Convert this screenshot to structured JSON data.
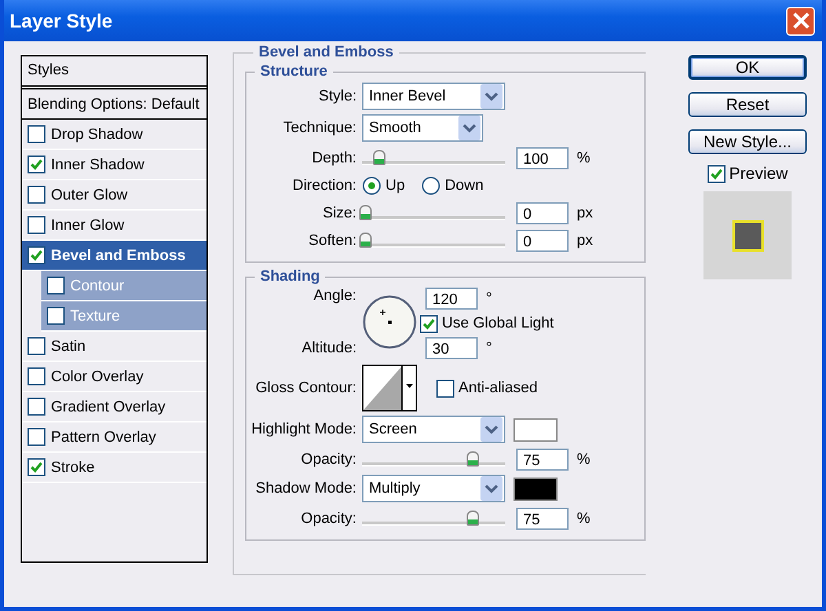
{
  "window": {
    "title": "Layer Style"
  },
  "styles_list": {
    "header": "Styles",
    "items": [
      {
        "label": "Blending Options: Default",
        "kind": "plain",
        "selected": false
      },
      {
        "label": "Drop Shadow",
        "kind": "check",
        "checked": false,
        "selected": false
      },
      {
        "label": "Inner Shadow",
        "kind": "check",
        "checked": true,
        "selected": false
      },
      {
        "label": "Outer Glow",
        "kind": "check",
        "checked": false,
        "selected": false
      },
      {
        "label": "Inner Glow",
        "kind": "check",
        "checked": false,
        "selected": false
      },
      {
        "label": "Bevel and Emboss",
        "kind": "check",
        "checked": true,
        "selected": true,
        "children": [
          {
            "label": "Contour",
            "kind": "check",
            "checked": false,
            "selected": false
          },
          {
            "label": "Texture",
            "kind": "check",
            "checked": false,
            "selected": false
          }
        ]
      },
      {
        "label": "Satin",
        "kind": "check",
        "checked": false,
        "selected": false
      },
      {
        "label": "Color Overlay",
        "kind": "check",
        "checked": false,
        "selected": false
      },
      {
        "label": "Gradient Overlay",
        "kind": "check",
        "checked": false,
        "selected": false
      },
      {
        "label": "Pattern Overlay",
        "kind": "check",
        "checked": false,
        "selected": false
      },
      {
        "label": "Stroke",
        "kind": "check",
        "checked": true,
        "selected": false
      }
    ]
  },
  "panel": {
    "title": "Bevel and Emboss",
    "structure": {
      "title": "Structure",
      "rows": [
        {
          "kind": "select",
          "label": "Style:",
          "value": "Inner Bevel",
          "wide": true
        },
        {
          "kind": "select",
          "label": "Technique:",
          "value": "Smooth",
          "wide": false
        },
        {
          "kind": "slider",
          "label": "Depth:",
          "level": 0.1,
          "value": "100",
          "unit": "%"
        },
        {
          "kind": "radio",
          "label": "Direction:",
          "options": [
            {
              "label": "Up",
              "selected": true
            },
            {
              "label": "Down",
              "selected": false
            }
          ]
        },
        {
          "kind": "slider",
          "label": "Size:",
          "level": 0,
          "value": "0",
          "unit": "px"
        },
        {
          "kind": "slider",
          "label": "Soften:",
          "level": 0,
          "value": "0",
          "unit": "px"
        }
      ]
    },
    "shading": {
      "title": "Shading",
      "angle": {
        "label": "Angle:",
        "value": "120",
        "unit": "°"
      },
      "global_light": {
        "label": "Use Global Light",
        "checked": true
      },
      "altitude": {
        "label": "Altitude:",
        "value": "30",
        "unit": "°"
      },
      "gloss_contour": {
        "label": "Gloss Contour:"
      },
      "anti_aliased": {
        "label": "Anti-aliased",
        "checked": false
      },
      "rows": [
        {
          "kind": "select",
          "label": "Highlight Mode:",
          "value": "Screen",
          "color": "#ffffff"
        },
        {
          "kind": "slider",
          "label": "Opacity:",
          "level": 0.75,
          "value": "75",
          "unit": "%"
        },
        {
          "kind": "select",
          "label": "Shadow Mode:",
          "value": "Multiply",
          "color": "#000000"
        },
        {
          "kind": "slider",
          "label": "Opacity:",
          "level": 0.75,
          "value": "75",
          "unit": "%"
        }
      ]
    }
  },
  "buttons": [
    {
      "label": "OK",
      "default": true
    },
    {
      "label": "Reset",
      "default": false
    },
    {
      "label": "New Style...",
      "default": false
    }
  ],
  "preview": {
    "label": "Preview",
    "checked": true
  }
}
